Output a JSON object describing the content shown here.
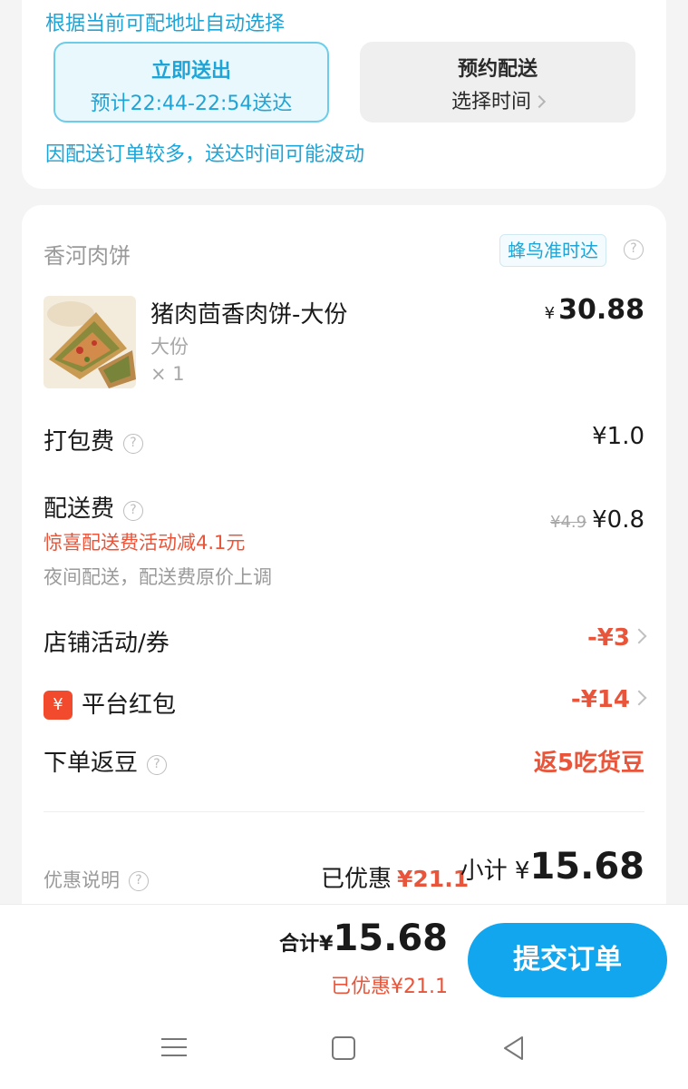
{
  "delivery": {
    "auto_hint": "根据当前可配地址自动选择",
    "now_title": "立即送出",
    "now_eta": "预计22:44-22:54送达",
    "schedule_title": "预约配送",
    "schedule_sub": "选择时间",
    "busy_hint": "因配送订单较多，送达时间可能波动"
  },
  "shop": {
    "name": "香河肉饼",
    "tag": "蜂鸟准时达"
  },
  "item": {
    "name": "猪肉茴香肉饼-大份",
    "spec": "大份",
    "qty": "× 1",
    "price_symbol": "¥",
    "price": "30.88"
  },
  "fees": {
    "packing_label": "打包费",
    "packing_value": "¥1.0",
    "delivery_label": "配送费",
    "delivery_promo": "惊喜配送费活动减4.1元",
    "delivery_note": "夜间配送，配送费原价上调",
    "delivery_original": "¥4.9",
    "delivery_value": "¥0.8"
  },
  "discounts": {
    "shop_label": "店铺活动/券",
    "shop_value": "-¥3",
    "redpack_icon": "¥",
    "redpack_label": "平台红包",
    "redpack_value": "-¥14",
    "bean_label": "下单返豆",
    "bean_value": "返5吃货豆"
  },
  "summary": {
    "note_label": "优惠说明",
    "discounted_label": "已优惠",
    "discounted_amount": "¥21.1",
    "subtotal_label": "小计",
    "subtotal_symbol": "¥",
    "subtotal_amount": "15.68"
  },
  "footer": {
    "total_label": "合计¥",
    "total_amount": "15.68",
    "total_discount": "已优惠¥21.1",
    "submit_label": "提交订单"
  },
  "colors": {
    "accent_blue": "#1ea4d6",
    "button_blue": "#12a6ef",
    "discount_red": "#e8553a"
  }
}
